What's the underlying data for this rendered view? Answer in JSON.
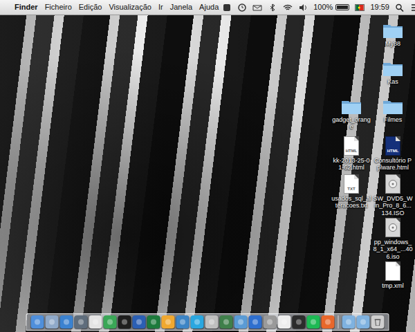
{
  "menu_bar": {
    "app": "Finder",
    "menus": [
      "Ficheiro",
      "Edição",
      "Visualização",
      "Ir",
      "Janela",
      "Ajuda"
    ],
    "battery": {
      "reading": "100%",
      "level": 1
    },
    "clock": "19:59"
  },
  "desktop": {
    "icons": [
      {
        "label": "My88",
        "kind": "folder"
      },
      {
        "label": "Kas",
        "kind": "folder"
      },
      {
        "label": "gadget_orange",
        "kind": "folder"
      },
      {
        "label": "Filmes",
        "kind": "folder"
      },
      {
        "label": "kk-2013-25-01-62.html",
        "kind": "file",
        "tag": "HTML"
      },
      {
        "label": "Consultório Pplware.html",
        "kind": "web-file",
        "tag": "HTML"
      },
      {
        "label": "usados_sql_alteracoes.txt",
        "kind": "file",
        "tag": "TXT"
      },
      {
        "label": "SW_DVD5_Win_Pro_8_6...134.ISO",
        "kind": "disk-image"
      },
      {
        "label": "pp_windows_8_1_x64_...406.iso",
        "kind": "disk-image"
      },
      {
        "label": "tmp.xml",
        "kind": "file",
        "tag": ""
      }
    ]
  },
  "dock": {
    "apps": [
      {
        "color": "#4f8fdb"
      },
      {
        "color": "#8fa9c9"
      },
      {
        "color": "#3b82d0"
      },
      {
        "color": "#5f6d7c"
      },
      {
        "color": "#e4e4e4"
      },
      {
        "color": "#3aa757"
      },
      {
        "color": "#1e1e1e"
      },
      {
        "color": "#2b5fb4"
      },
      {
        "color": "#1d7a3c"
      },
      {
        "color": "#f0a830"
      },
      {
        "color": "#3d85c6"
      },
      {
        "color": "#2aa7e0"
      },
      {
        "color": "#bfbfbf"
      },
      {
        "color": "#3f7f4a"
      },
      {
        "color": "#5a9bd5"
      },
      {
        "color": "#2e6fcf"
      },
      {
        "color": "#9a9a9a"
      },
      {
        "color": "#eeeeee"
      },
      {
        "color": "#2c2c2c"
      },
      {
        "color": "#1db954"
      },
      {
        "color": "#e8672b"
      }
    ],
    "stacks": [
      {
        "color": "#7fb2e0"
      },
      {
        "color": "#7fb2e0"
      },
      {
        "color": "#cfcfcf"
      }
    ]
  }
}
